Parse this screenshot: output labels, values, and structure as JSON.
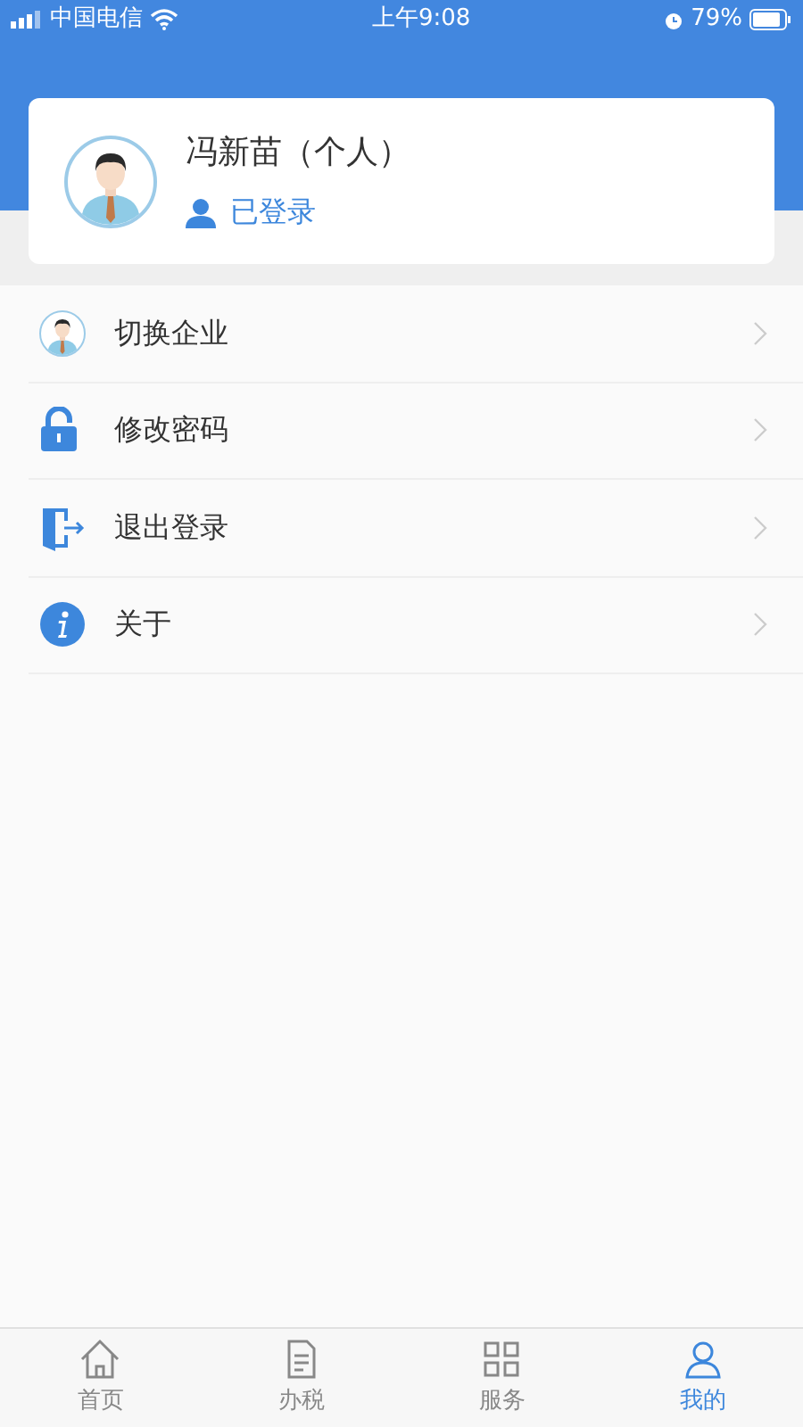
{
  "status_bar": {
    "carrier": "中国电信",
    "time": "上午9:08",
    "battery": "79%"
  },
  "profile": {
    "name": "冯新苗（个人）",
    "status": "已登录"
  },
  "menu": [
    {
      "kind": "switch",
      "label": "切换企业"
    },
    {
      "kind": "lock",
      "label": "修改密码"
    },
    {
      "kind": "logout",
      "label": "退出登录"
    },
    {
      "kind": "info",
      "label": "关于"
    }
  ],
  "tabs": [
    {
      "kind": "home",
      "label": "首页",
      "selected": false
    },
    {
      "kind": "tax",
      "label": "办税",
      "selected": false
    },
    {
      "kind": "service",
      "label": "服务",
      "selected": false
    },
    {
      "kind": "me",
      "label": "我的",
      "selected": true
    }
  ]
}
